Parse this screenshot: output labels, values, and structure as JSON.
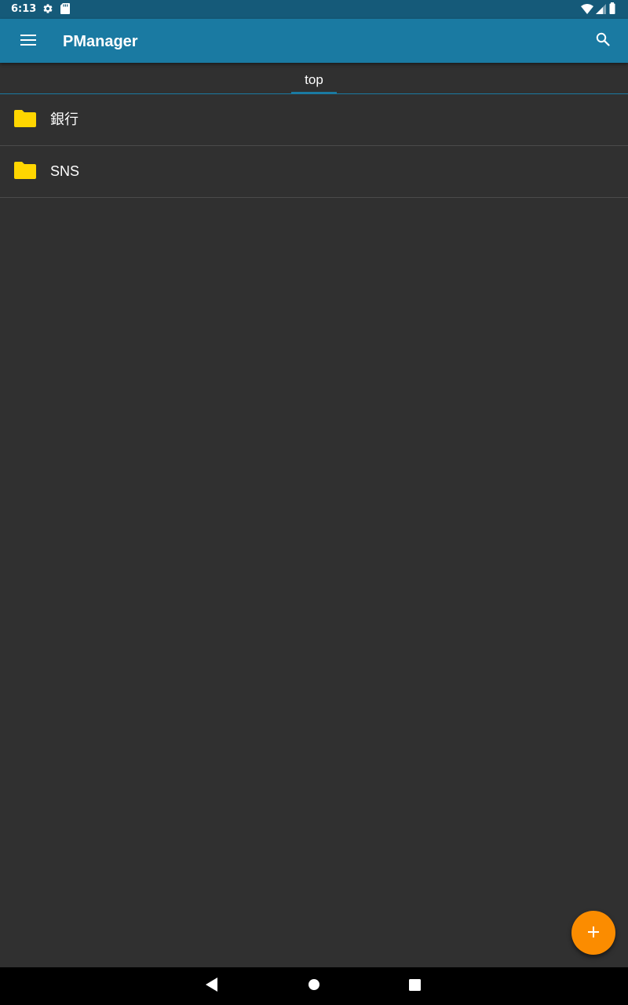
{
  "status_bar": {
    "time": "6:13",
    "left_icons": [
      "gear-icon",
      "sd-card-icon"
    ],
    "right_icons": [
      "wifi-icon",
      "signal-icon",
      "battery-icon"
    ]
  },
  "app_bar": {
    "title": "PManager",
    "menu_icon": "menu-icon",
    "search_icon": "search-icon",
    "color": "#1a7aa2"
  },
  "breadcrumb": {
    "tabs": [
      {
        "label": "top",
        "selected": true
      }
    ]
  },
  "folders": [
    {
      "label": "銀行",
      "icon": "folder-icon"
    },
    {
      "label": "SNS",
      "icon": "folder-icon"
    }
  ],
  "colors": {
    "background": "#303030",
    "status_bar": "#155a79",
    "folder": "#ffd600",
    "fab": "#fb8c00"
  },
  "fab": {
    "icon": "plus-icon"
  },
  "nav_bar": {
    "buttons": [
      "back-icon",
      "home-icon",
      "recents-icon"
    ]
  }
}
